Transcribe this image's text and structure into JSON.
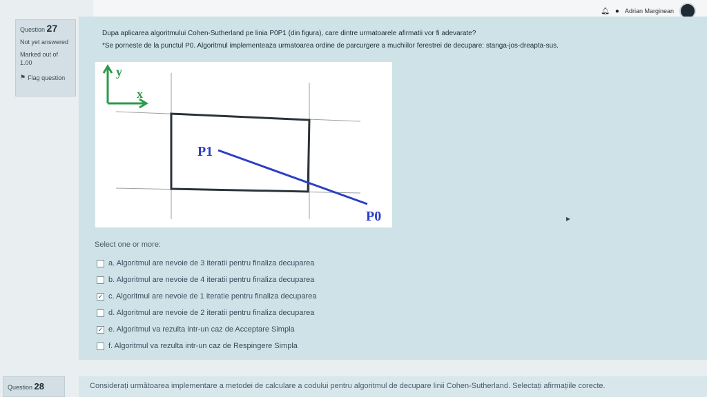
{
  "header": {
    "user_name": "Adrian Marginean",
    "bell_icon": "bell-icon",
    "chat_icon": "chat-icon"
  },
  "question": {
    "label": "Question",
    "number": "27",
    "status": "Not yet answered",
    "marks": "Marked out of 1.00",
    "flag_label": "Flag question",
    "text_line1": "Dupa aplicarea algoritmului Cohen-Sutherland pe linia P0P1 (din figura), care dintre urmatoarele afirmatii vor fi adevarate?",
    "text_line2": "*Se porneste de la punctul P0. Algoritmul implementeaza urmatoarea ordine de parcurgere a muchiilor ferestrei de decupare: stanga-jos-dreapta-sus."
  },
  "figure": {
    "axis_y": "y",
    "axis_x": "x",
    "p1_label": "P1",
    "p0_label": "P0",
    "line_color": "#2b3fc4",
    "window_color": "#2b3338"
  },
  "answers": {
    "prompt": "Select one or more:",
    "options": [
      {
        "text": "a. Algoritmul are nevoie de 3 iteratii pentru finaliza decuparea",
        "checked": false
      },
      {
        "text": "b. Algoritmul are nevoie de 4 iteratii pentru finaliza decuparea",
        "checked": false
      },
      {
        "text": "c. Algoritmul are nevoie de 1 iteratie pentru finaliza decuparea",
        "checked": true
      },
      {
        "text": "d. Algoritmul are nevoie de 2 iteratii pentru finaliza decuparea",
        "checked": false
      },
      {
        "text": "e. Algoritmul va rezulta intr-un caz de Acceptare Simpla",
        "checked": true
      },
      {
        "text": "f. Algoritmul va rezulta intr-un caz de Respingere Simpla",
        "checked": false
      }
    ]
  },
  "next_question": {
    "label": "Question",
    "number": "28",
    "text": "Considerați următoarea implementare a metodei de calculare a codului pentru algoritmul de decupare linii Cohen-Sutherland. Selectați afirmațiile corecte."
  }
}
